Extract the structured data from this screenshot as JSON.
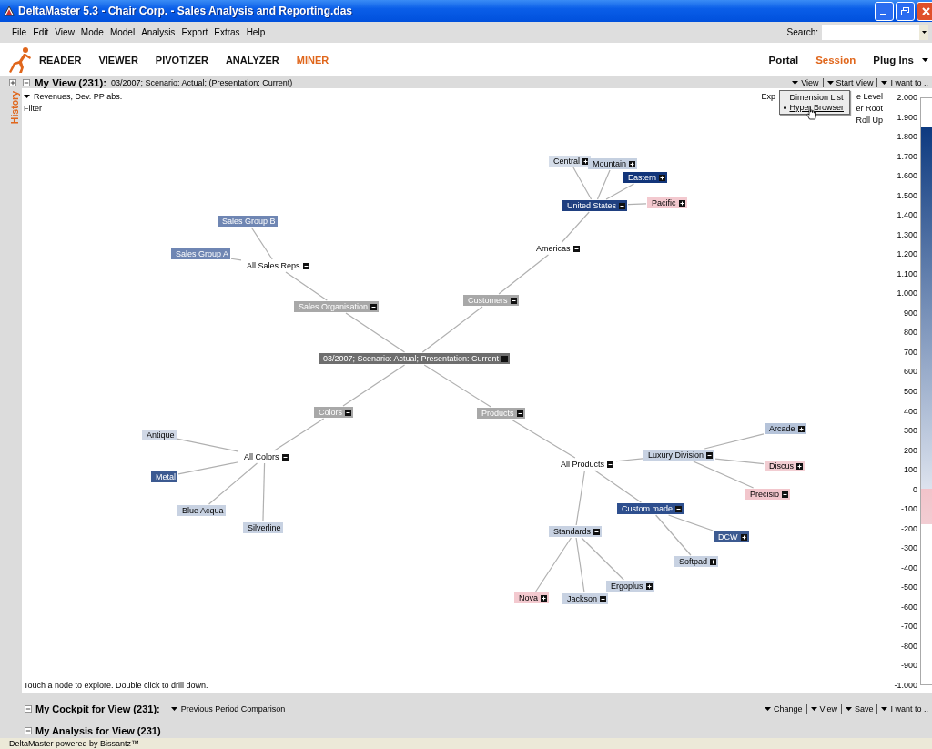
{
  "window": {
    "title": "DeltaMaster 5.3 - Chair Corp. - Sales Analysis and Reporting.das"
  },
  "menu_bar": [
    "File",
    "Edit",
    "View",
    "Mode",
    "Model",
    "Analysis",
    "Export",
    "Extras",
    "Help"
  ],
  "search": {
    "label": "Search:"
  },
  "modes": [
    {
      "label": "READER",
      "selected": false
    },
    {
      "label": "VIEWER",
      "selected": false
    },
    {
      "label": "PIVOTIZER",
      "selected": false
    },
    {
      "label": "ANALYZER",
      "selected": false
    },
    {
      "label": "MINER",
      "selected": true
    }
  ],
  "nav_links": [
    {
      "label": "Portal",
      "selected": false,
      "kind": "link"
    },
    {
      "label": "Session",
      "selected": true,
      "kind": "link"
    },
    {
      "label": "Plug Ins",
      "selected": false,
      "kind": "dropdown"
    }
  ],
  "view": {
    "title": "My View (231):",
    "context": "03/2007; Scenario: Actual; (Presentation: Current)",
    "expanded": true,
    "actions": [
      "View",
      "Start View",
      "I want to .."
    ],
    "side_tab": "History",
    "measure": "Revenues, Dev. PP abs.",
    "filter": "Filter",
    "hint": "Touch a node to explore. Double click to drill down."
  },
  "view_options": [
    "Exp",
    "e Level",
    "er Root",
    "Roll Up"
  ],
  "view_menu": [
    {
      "label": "Dimension List",
      "selected": false
    },
    {
      "label": "Hyper Browser",
      "selected": true
    }
  ],
  "tree": {
    "label": "03/2007; Scenario: Actual; Presentation: Current",
    "color": "#6e6e6e",
    "expanded": true,
    "children": [
      {
        "label": "Sales Organisation",
        "color": "#a8a8a8",
        "expanded": true,
        "children": [
          {
            "label": "All Sales Reps",
            "expanded": true,
            "children": [
              {
                "label": "Sales Group B",
                "color": "#6f86b3"
              },
              {
                "label": "Sales Group A",
                "color": "#6f86b3"
              }
            ]
          }
        ]
      },
      {
        "label": "Customers",
        "color": "#a8a8a8",
        "expanded": true,
        "children": [
          {
            "label": "Americas",
            "expanded": true,
            "children": [
              {
                "label": "United States",
                "color": "#1f3f80",
                "expanded": true,
                "children": [
                  {
                    "label": "Central",
                    "color": "#d5dde9",
                    "expanded": false
                  },
                  {
                    "label": "Mountain",
                    "color": "#c5d0e0",
                    "expanded": false
                  },
                  {
                    "label": "Eastern",
                    "color": "#12357a",
                    "expanded": false
                  },
                  {
                    "label": "Pacific",
                    "color": "#f3c9cf",
                    "expanded": false
                  }
                ]
              }
            ]
          }
        ]
      },
      {
        "label": "Colors",
        "color": "#a8a8a8",
        "expanded": true,
        "children": [
          {
            "label": "All Colors",
            "expanded": true,
            "children": [
              {
                "label": "Antique",
                "color": "#d0d8e6"
              },
              {
                "label": "Metal",
                "color": "#3c5a91"
              },
              {
                "label": "Blue Acqua",
                "color": "#c8d2e2"
              },
              {
                "label": "Silverline",
                "color": "#c8d2e2"
              }
            ]
          }
        ]
      },
      {
        "label": "Products",
        "color": "#a8a8a8",
        "expanded": true,
        "children": [
          {
            "label": "All Products",
            "expanded": true,
            "children": [
              {
                "label": "Luxury Division",
                "color": "#c8d2e2",
                "expanded": true,
                "children": [
                  {
                    "label": "Arcade",
                    "color": "#b5c3d9",
                    "expanded": false
                  },
                  {
                    "label": "Discus",
                    "color": "#f2cdd2",
                    "expanded": false
                  },
                  {
                    "label": "Precisio",
                    "color": "#f2c6cc",
                    "expanded": false
                  }
                ]
              },
              {
                "label": "Custom made",
                "color": "#2e4f8e",
                "expanded": true,
                "children": [
                  {
                    "label": "DCW",
                    "color": "#3c5a91",
                    "expanded": false
                  },
                  {
                    "label": "Softpad",
                    "color": "#c8d2e2",
                    "expanded": false
                  }
                ]
              },
              {
                "label": "Standards",
                "color": "#c8d2e2",
                "expanded": true,
                "children": [
                  {
                    "label": "Nova",
                    "color": "#f3c9cf",
                    "expanded": false
                  },
                  {
                    "label": "Jackson",
                    "color": "#c8d2e2",
                    "expanded": false
                  },
                  {
                    "label": "Ergoplus",
                    "color": "#c8d2e2",
                    "expanded": false
                  }
                ]
              }
            ]
          }
        ]
      }
    ]
  },
  "legend": {
    "labels": [
      "2.000",
      "1.900",
      "1.800",
      "1.700",
      "1.600",
      "1.500",
      "1.400",
      "1.300",
      "1.200",
      "1.100",
      "1.000",
      "900",
      "800",
      "700",
      "600",
      "500",
      "400",
      "300",
      "200",
      "100",
      "0",
      "-100",
      "-200",
      "-300",
      "-400",
      "-500",
      "-600",
      "-700",
      "-800",
      "-900",
      "-1.000"
    ]
  },
  "cockpit": {
    "title": "My Cockpit for View (231):",
    "preset": "Previous Period Comparison",
    "expanded": true,
    "actions": [
      "Change",
      "View",
      "Save",
      "I want to .."
    ]
  },
  "analysis": {
    "title": "My Analysis for View (231)",
    "expanded": true
  },
  "status_bar": "DeltaMaster powered by Bissantz™"
}
